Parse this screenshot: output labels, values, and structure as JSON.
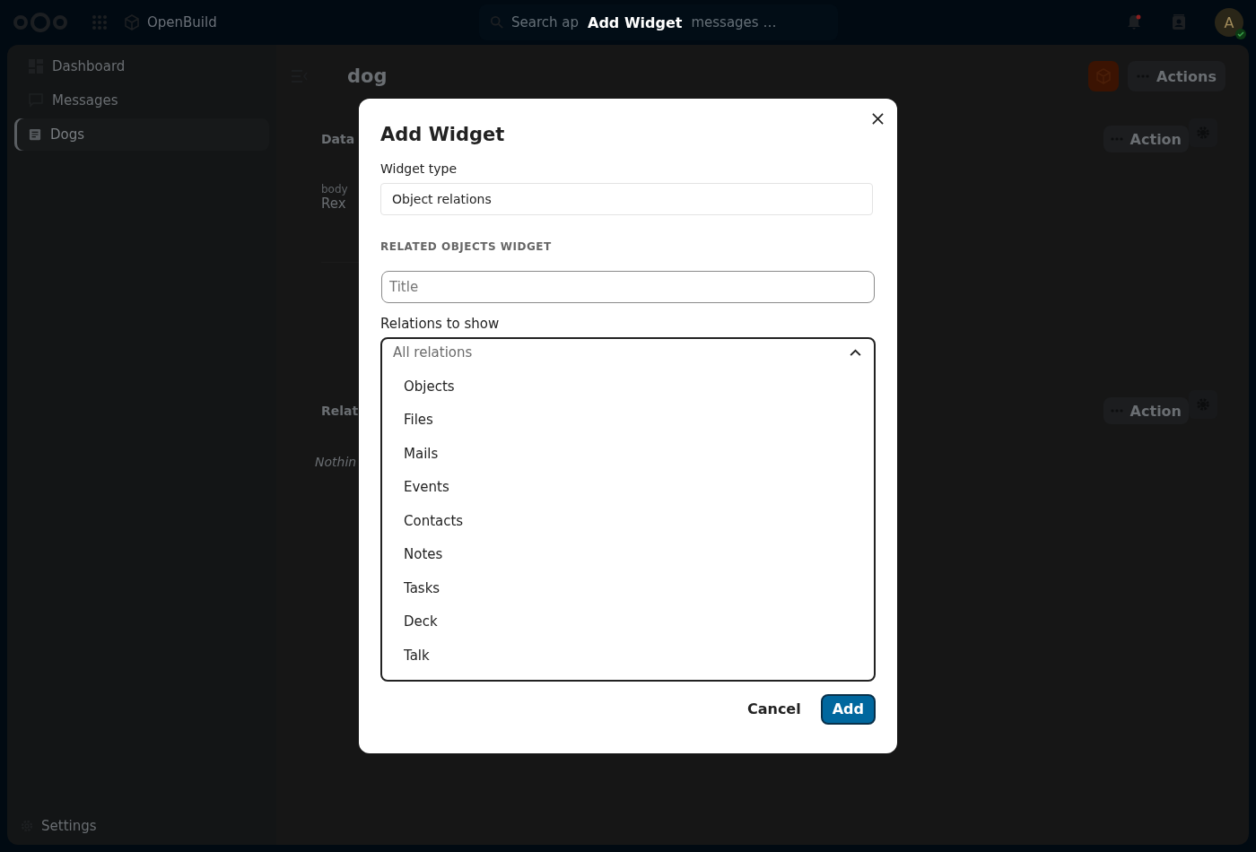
{
  "topbar": {
    "app_name": "OpenBuild",
    "search_parts": [
      "Search ap",
      "messages …"
    ],
    "overlay_title": "Add Widget",
    "avatar_initial": "A",
    "notification_unread": true
  },
  "sidebar": {
    "items": [
      {
        "label": "Dashboard",
        "kind": "dashboard",
        "selected": false
      },
      {
        "label": "Messages",
        "kind": "messages",
        "selected": false
      },
      {
        "label": "Dogs",
        "kind": "document",
        "selected": true
      }
    ],
    "settings": "Settings"
  },
  "page": {
    "title": "dog",
    "actions_label": "Actions",
    "sections": [
      {
        "heading": "Data",
        "actions_label": "Action",
        "field_label": "body",
        "field_value": "Rex"
      },
      {
        "heading": "Relat",
        "actions_label": "Action",
        "empty_text": "Nothin"
      }
    ]
  },
  "dialog": {
    "title": "Add Widget",
    "widget_type_label": "Widget type",
    "widget_type_value": "Object relations",
    "section_heading": "RELATED OBJECTS WIDGET",
    "title_placeholder": "Title",
    "relations_label": "Relations to show",
    "relations_placeholder": "All relations",
    "expanded": true,
    "options": [
      {
        "label": "Objects"
      },
      {
        "label": "Files"
      },
      {
        "label": "Mails"
      },
      {
        "label": "Events"
      },
      {
        "label": "Contacts"
      },
      {
        "label": "Notes"
      },
      {
        "label": "Tasks"
      },
      {
        "label": "Deck"
      },
      {
        "label": "Talk"
      }
    ],
    "cancel": "Cancel",
    "confirm": "Add"
  }
}
